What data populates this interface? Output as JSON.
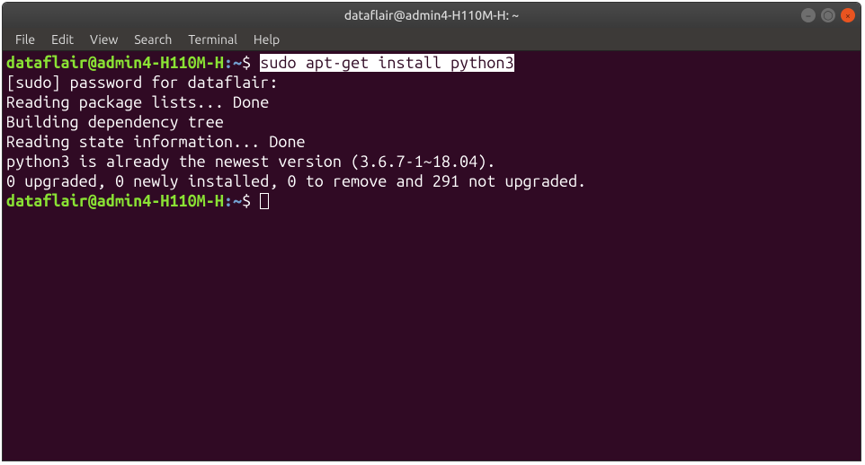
{
  "titlebar": {
    "title": "dataflair@admin4-H110M-H: ~"
  },
  "menubar": {
    "items": [
      "File",
      "Edit",
      "View",
      "Search",
      "Terminal",
      "Help"
    ]
  },
  "terminal": {
    "prompt": {
      "user_host": "dataflair@admin4-H110M-H",
      "separator": ":",
      "path": "~",
      "symbol": "$"
    },
    "command_highlighted": "sudo apt-get install python3",
    "output_lines": [
      "[sudo] password for dataflair:",
      "Reading package lists... Done",
      "Building dependency tree",
      "Reading state information... Done",
      "python3 is already the newest version (3.6.7-1~18.04).",
      "0 upgraded, 0 newly installed, 0 to remove and 291 not upgraded."
    ]
  },
  "window_controls": {
    "minimize_glyph": "–",
    "maximize_glyph": "◯",
    "close_glyph": "×"
  }
}
